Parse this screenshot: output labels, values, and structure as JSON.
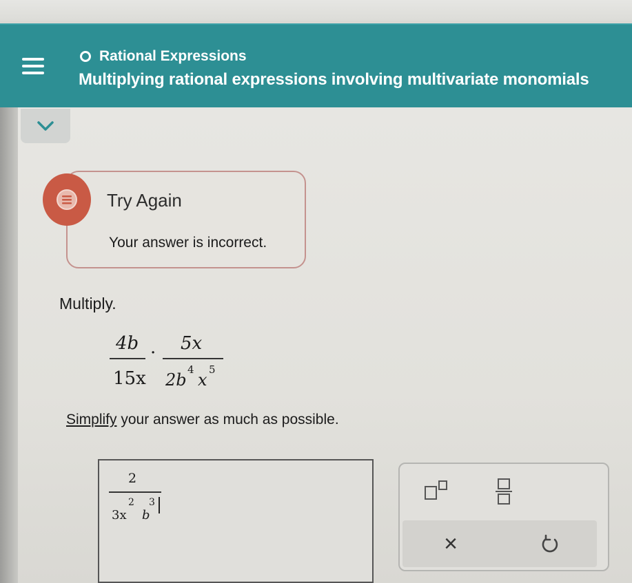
{
  "header": {
    "topic": "Rational Expressions",
    "lesson_title": "Multiplying rational expressions involving multivariate monomials"
  },
  "feedback": {
    "title": "Try Again",
    "message": "Your answer is incorrect."
  },
  "problem": {
    "prompt": "Multiply.",
    "expr": {
      "frac1_num": "4b",
      "frac1_den": "15x",
      "dot": "·",
      "frac2_num": "5x",
      "frac2_den_coef": "2b",
      "frac2_den_exp1": "4",
      "frac2_den_var2": "x",
      "frac2_den_exp2": "5"
    },
    "instructions_link": "Simplify",
    "instructions_rest": " your answer as much as possible."
  },
  "answer": {
    "numerator": "2",
    "den_coef": "3x",
    "den_exp1": "2",
    "den_var2": "b",
    "den_exp2": "3"
  },
  "keypad": {
    "keys": [
      "superscript-key",
      "fraction-key",
      "clear-key",
      "undo-key"
    ],
    "clear_symbol": "×"
  },
  "colors": {
    "header_bg": "#2d8f94",
    "error": "#c95a45"
  }
}
